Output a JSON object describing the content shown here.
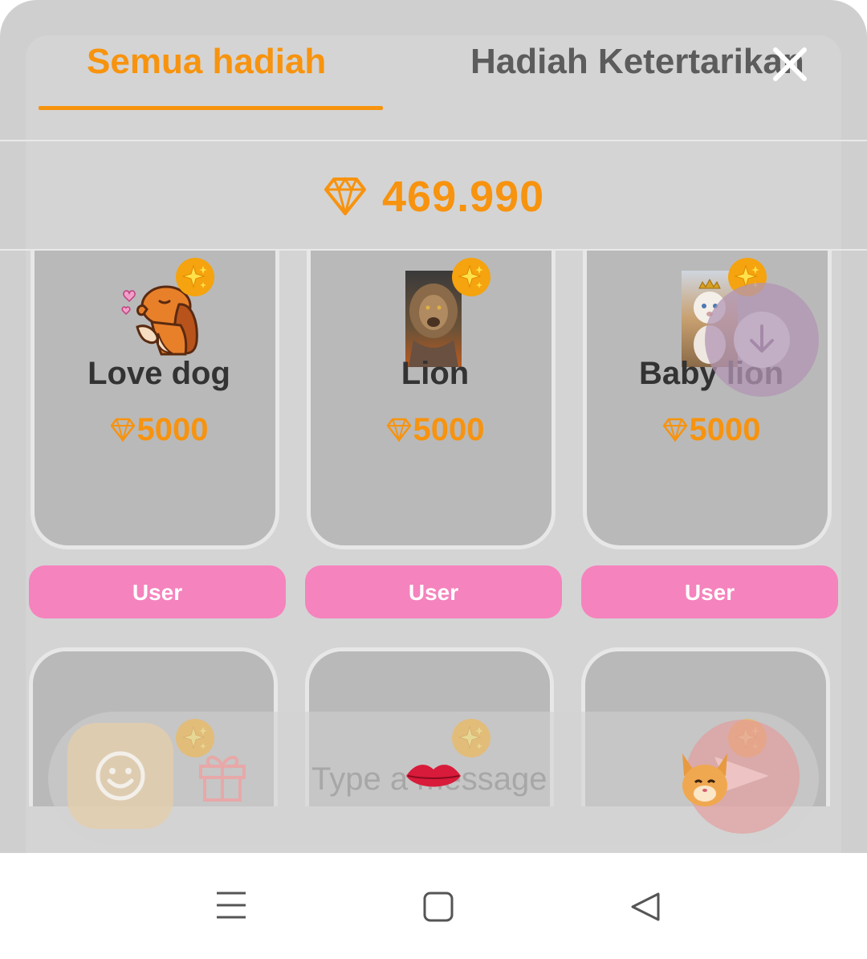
{
  "tabs": {
    "all_gifts": "Semua hadiah",
    "interest_gifts": "Hadiah Ketertarikan"
  },
  "balance": {
    "icon": "diamond-icon",
    "value": "469.990"
  },
  "gifts": [
    {
      "name": "Love dog",
      "price": "5000",
      "badge": "User",
      "icon": "love-dog-sticker"
    },
    {
      "name": "Lion",
      "price": "5000",
      "badge": "User",
      "icon": "lion-image"
    },
    {
      "name": "Baby lion",
      "price": "5000",
      "badge": "User",
      "icon": "baby-lion-image"
    }
  ],
  "more_gifts": [
    {
      "icon": "lips-icon"
    },
    {
      "icon": "bunny-face-icon"
    }
  ],
  "chat": {
    "placeholder": "Type a message"
  },
  "colors": {
    "accent": "#f7930e",
    "badge": "#f583bd",
    "card": "#b9b9b9",
    "background": "#cfcfcf"
  },
  "system_nav": {
    "menu": "menu-icon",
    "home": "home-icon",
    "back": "back-icon"
  }
}
